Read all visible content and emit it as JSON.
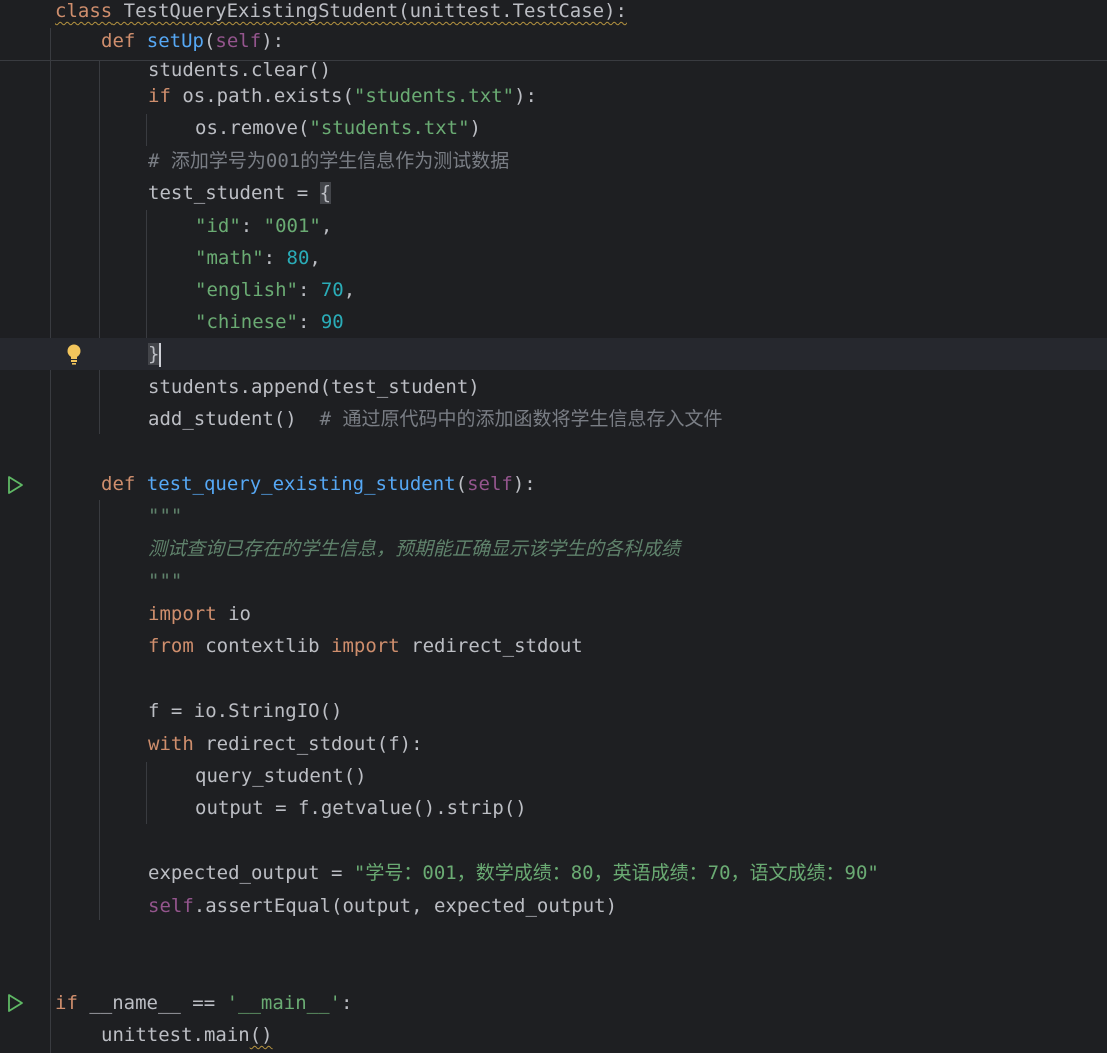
{
  "editor": {
    "lines": [
      {
        "tokens": [
          {
            "t": "class",
            "c": "kw wavy"
          },
          {
            "t": " TestQueryExistingStudent(unittest.TestCase):",
            "c": "wavy"
          }
        ]
      },
      {
        "tokens": [
          {
            "t": "def ",
            "c": "kw"
          },
          {
            "t": "setUp",
            "c": "fn"
          },
          {
            "t": "(",
            "c": ""
          },
          {
            "t": "self",
            "c": "self"
          },
          {
            "t": "):",
            "c": ""
          }
        ]
      },
      {
        "tokens": [
          {
            "t": "students.clear()",
            "c": ""
          }
        ]
      },
      {
        "tokens": [
          {
            "t": "if ",
            "c": "kw"
          },
          {
            "t": "os.path.exists(",
            "c": ""
          },
          {
            "t": "\"students.txt\"",
            "c": "str"
          },
          {
            "t": "):",
            "c": ""
          }
        ]
      },
      {
        "tokens": [
          {
            "t": "os.remove(",
            "c": ""
          },
          {
            "t": "\"students.txt\"",
            "c": "str"
          },
          {
            "t": ")",
            "c": ""
          }
        ]
      },
      {
        "tokens": [
          {
            "t": "# ",
            "c": "cmt"
          },
          {
            "t": "添加学号为",
            "c": "cmt cn"
          },
          {
            "t": "001",
            "c": "cmt"
          },
          {
            "t": "的学生信息作为测试数据",
            "c": "cmt cn"
          }
        ]
      },
      {
        "tokens": [
          {
            "t": "test_student = ",
            "c": ""
          },
          {
            "t": "{",
            "c": "brace-hl"
          }
        ]
      },
      {
        "tokens": [
          {
            "t": "\"id\"",
            "c": "str"
          },
          {
            "t": ": ",
            "c": ""
          },
          {
            "t": "\"001\"",
            "c": "str"
          },
          {
            "t": ",",
            "c": ""
          }
        ]
      },
      {
        "tokens": [
          {
            "t": "\"math\"",
            "c": "str"
          },
          {
            "t": ": ",
            "c": ""
          },
          {
            "t": "80",
            "c": "num"
          },
          {
            "t": ",",
            "c": ""
          }
        ]
      },
      {
        "tokens": [
          {
            "t": "\"english\"",
            "c": "str"
          },
          {
            "t": ": ",
            "c": ""
          },
          {
            "t": "70",
            "c": "num"
          },
          {
            "t": ",",
            "c": ""
          }
        ]
      },
      {
        "tokens": [
          {
            "t": "\"chinese\"",
            "c": "str"
          },
          {
            "t": ": ",
            "c": ""
          },
          {
            "t": "90",
            "c": "num"
          }
        ]
      },
      {
        "tokens": [
          {
            "t": "}",
            "c": "brace-hl"
          },
          {
            "t": "",
            "c": "caret"
          }
        ]
      },
      {
        "tokens": [
          {
            "t": "students.append(test_student)",
            "c": ""
          }
        ]
      },
      {
        "tokens": [
          {
            "t": "add_student()  ",
            "c": ""
          },
          {
            "t": "# ",
            "c": "cmt"
          },
          {
            "t": "通过原代码中的添加函数将学生信息存入文件",
            "c": "cmt cn"
          }
        ]
      },
      {
        "tokens": []
      },
      {
        "tokens": [
          {
            "t": "def ",
            "c": "kw"
          },
          {
            "t": "test_query_existing_student",
            "c": "fn"
          },
          {
            "t": "(",
            "c": ""
          },
          {
            "t": "self",
            "c": "self"
          },
          {
            "t": "):",
            "c": ""
          }
        ]
      },
      {
        "tokens": [
          {
            "t": "\"\"\"",
            "c": "doc"
          }
        ]
      },
      {
        "tokens": [
          {
            "t": "测试查询已存在的学生信息，预期能正确显示该学生的各科成绩",
            "c": "doc cn"
          }
        ]
      },
      {
        "tokens": [
          {
            "t": "\"\"\"",
            "c": "doc"
          }
        ]
      },
      {
        "tokens": [
          {
            "t": "import ",
            "c": "kw"
          },
          {
            "t": "io",
            "c": ""
          }
        ]
      },
      {
        "tokens": [
          {
            "t": "from ",
            "c": "kw"
          },
          {
            "t": "contextlib ",
            "c": ""
          },
          {
            "t": "import ",
            "c": "kw"
          },
          {
            "t": "redirect_stdout",
            "c": ""
          }
        ]
      },
      {
        "tokens": []
      },
      {
        "tokens": [
          {
            "t": "f = io.StringIO()",
            "c": ""
          }
        ]
      },
      {
        "tokens": [
          {
            "t": "with ",
            "c": "kw"
          },
          {
            "t": "redirect_stdout(f):",
            "c": ""
          }
        ]
      },
      {
        "tokens": [
          {
            "t": "query_student()",
            "c": ""
          }
        ]
      },
      {
        "tokens": [
          {
            "t": "output = f.getvalue().strip()",
            "c": ""
          }
        ]
      },
      {
        "tokens": []
      },
      {
        "tokens": [
          {
            "t": "expected_output = ",
            "c": ""
          },
          {
            "t": "\"",
            "c": "str"
          },
          {
            "t": "学号：",
            "c": "str cn"
          },
          {
            "t": "001",
            "c": "str"
          },
          {
            "t": "，数学成绩：",
            "c": "str cn"
          },
          {
            "t": "80",
            "c": "str"
          },
          {
            "t": "，英语成绩：",
            "c": "str cn"
          },
          {
            "t": "70",
            "c": "str"
          },
          {
            "t": "，语文成绩：",
            "c": "str cn"
          },
          {
            "t": "90\"",
            "c": "str"
          }
        ]
      },
      {
        "tokens": [
          {
            "t": "self",
            "c": "self"
          },
          {
            "t": ".assertEqual(output, expected_output)",
            "c": ""
          }
        ]
      },
      {
        "tokens": []
      },
      {
        "tokens": []
      },
      {
        "tokens": [
          {
            "t": "if ",
            "c": "kw"
          },
          {
            "t": "__name__ == ",
            "c": ""
          },
          {
            "t": "'__main__'",
            "c": "str"
          },
          {
            "t": ":",
            "c": ""
          }
        ]
      },
      {
        "tokens": [
          {
            "t": "unittest.main",
            "c": ""
          },
          {
            "t": "()",
            "c": "wavy"
          }
        ]
      }
    ]
  },
  "gutter": {
    "run_icon_name": "run-icon",
    "bulb_icon_name": "lightbulb-icon"
  }
}
